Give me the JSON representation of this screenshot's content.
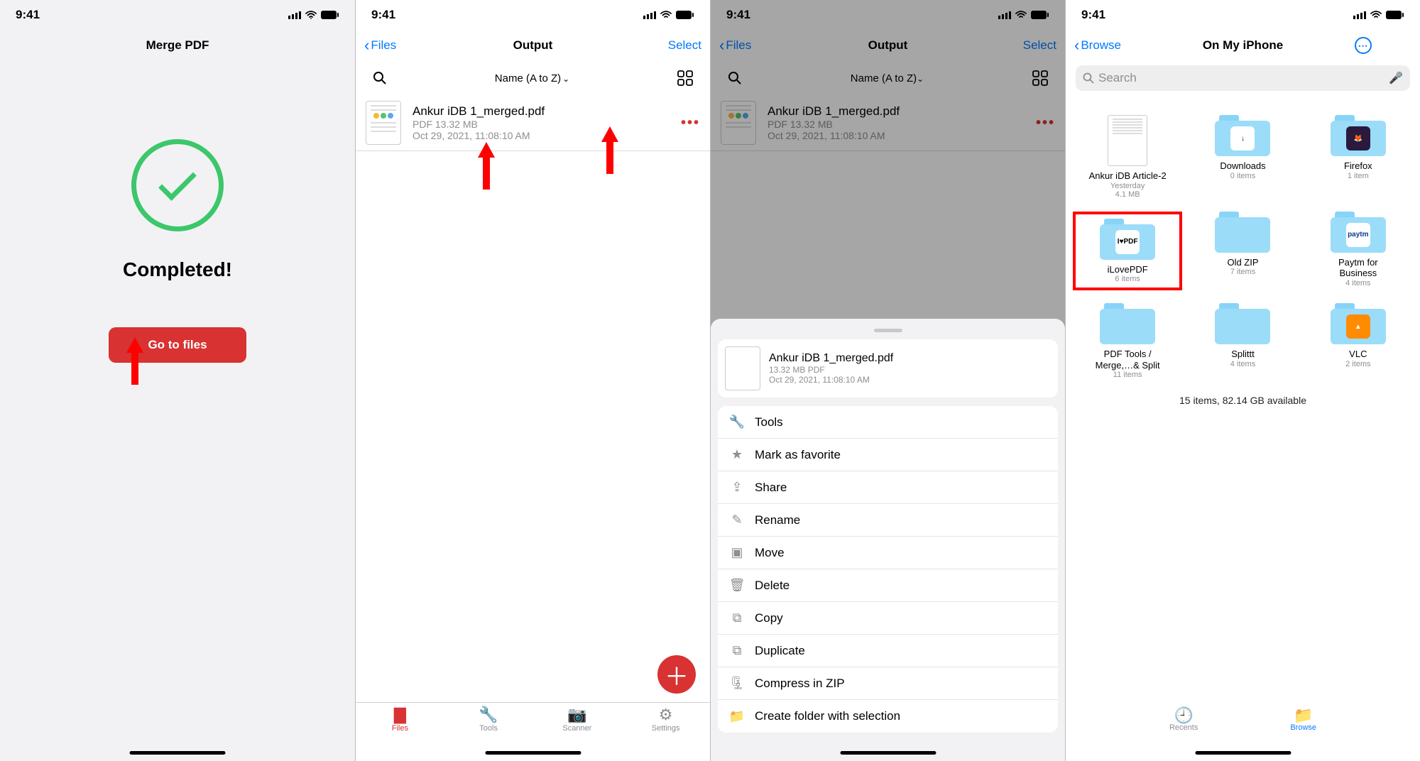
{
  "status_time": "9:41",
  "screen1": {
    "title": "Merge PDF",
    "completed_label": "Completed!",
    "go_button": "Go to files"
  },
  "screen2": {
    "back_label": "Files",
    "title": "Output",
    "select_label": "Select",
    "sort_label": "Name (A to Z)",
    "file": {
      "name": "Ankur iDB 1_merged.pdf",
      "meta1": "PDF 13.32 MB",
      "meta2": "Oct 29, 2021, 11:08:10 AM"
    },
    "tabs": [
      "Files",
      "Tools",
      "Scanner",
      "Settings"
    ]
  },
  "screen3": {
    "back_label": "Files",
    "title": "Output",
    "select_label": "Select",
    "sort_label": "Name (A to Z)",
    "file": {
      "name": "Ankur iDB 1_merged.pdf",
      "meta1": "13.32 MB PDF",
      "meta2": "Oct 29, 2021, 11:08:10 AM"
    },
    "menu": [
      "Tools",
      "Mark as favorite",
      "Share",
      "Rename",
      "Move",
      "Delete",
      "Copy",
      "Duplicate",
      "Compress in ZIP",
      "Create folder with selection"
    ]
  },
  "screen4": {
    "back_label": "Browse",
    "title": "On My iPhone",
    "search_placeholder": "Search",
    "items": [
      {
        "name": "Ankur iDB Article-2",
        "meta1": "Yesterday",
        "meta2": "4.1 MB",
        "kind": "doc"
      },
      {
        "name": "Downloads",
        "meta1": "0 items",
        "kind": "folder",
        "badge": "↓"
      },
      {
        "name": "Firefox",
        "meta1": "1 item",
        "kind": "folder",
        "badge": "🦊",
        "badgeBg": "#2b1a3d"
      },
      {
        "name": "iLovePDF",
        "meta1": "6 items",
        "kind": "folder",
        "badge": "I♥PDF",
        "highlight": true
      },
      {
        "name": "Old ZIP",
        "meta1": "7 items",
        "kind": "folder"
      },
      {
        "name": "Paytm for Business",
        "meta1": "4 items",
        "kind": "folder",
        "badge": "paytm",
        "badgeBg": "#fff",
        "badgeColor": "#0b3b8c"
      },
      {
        "name": "PDF Tools / Merge,…& Split",
        "meta1": "11 items",
        "kind": "folder"
      },
      {
        "name": "Splittt",
        "meta1": "4 items",
        "kind": "folder"
      },
      {
        "name": "VLC",
        "meta1": "2 items",
        "kind": "folder",
        "badge": "▲",
        "badgeBg": "#ff8c00",
        "badgeColor": "#fff"
      }
    ],
    "footer_summary": "15 items, 82.14 GB available",
    "tabs": {
      "recents": "Recents",
      "browse": "Browse"
    }
  }
}
